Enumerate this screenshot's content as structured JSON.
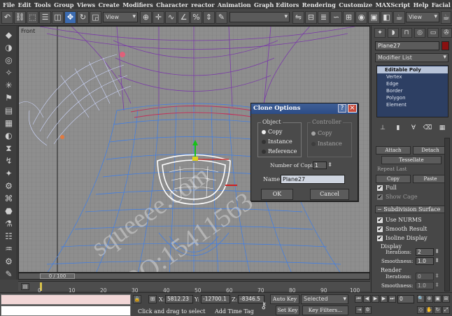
{
  "menu": [
    "File",
    "Edit",
    "Tools",
    "Group",
    "Views",
    "Create",
    "Modifiers",
    "Character",
    "reactor",
    "Animation",
    "Graph Editors",
    "Rendering",
    "Customize",
    "MAXScript",
    "Help",
    "Facial Studio"
  ],
  "toolbar": {
    "view_dropdown": "View",
    "view_dropdown_right": "View"
  },
  "viewport": {
    "label": "Front"
  },
  "watermark": {
    "line1": "squeeee.com",
    "line2": "QQ:15411563"
  },
  "clone_dialog": {
    "title": "Clone Options",
    "help": "?",
    "close": "×",
    "object_group": "Object",
    "options": [
      "Copy",
      "Instance",
      "Reference"
    ],
    "selected": "Copy",
    "controller_group": "Controller",
    "controller_options": [
      "Copy",
      "Instance"
    ],
    "number_label": "Number of Copies:",
    "number_value": "1",
    "name_label": "Name:",
    "name_value": "Plane27",
    "ok": "OK",
    "cancel": "Cancel"
  },
  "command_panel": {
    "object_name": "Plane27",
    "object_color": "#8a1010",
    "modifier_list": "Modifier List",
    "stack": [
      "Editable Poly",
      "Vertex",
      "Edge",
      "Border",
      "Polygon",
      "Element"
    ],
    "buttons": [
      "Attach",
      "Detach",
      "Tessellate",
      "Copy",
      "Paste"
    ],
    "repeat_last": "Repeat Last",
    "full": "Full",
    "hide_cage": "Show Cage",
    "subdivision_title": "Subdivision Surface",
    "use_nurms": "Use NURMS",
    "smooth_result": "Smooth Result",
    "isoline_display": "Isoline Display",
    "display_label": "Display",
    "iterations_label": "Iterations:",
    "iterations_value": "2",
    "smoothness_label": "Smoothness:",
    "smoothness_value": "1.0",
    "render_label": "Render",
    "render_iterations_value": "0",
    "render_smoothness_value": "1.0"
  },
  "timeline": {
    "frame_display": "0 / 100",
    "ticks": [
      "0",
      "10",
      "20",
      "30",
      "40",
      "50",
      "60",
      "70",
      "80",
      "90",
      "100"
    ]
  },
  "status": {
    "prompt": "Click and drag to select",
    "add_time_tag": "Add Time Tag",
    "x_label": "X:",
    "x_value": "5812.23",
    "y_label": "Y:",
    "y_value": "-12700.1",
    "z_label": "Z:",
    "z_value": "-8346.5",
    "auto_key": "Auto Key",
    "selected": "Selected",
    "set_key": "Set Key",
    "key_filters": "Key Filters...",
    "frame": "0"
  }
}
